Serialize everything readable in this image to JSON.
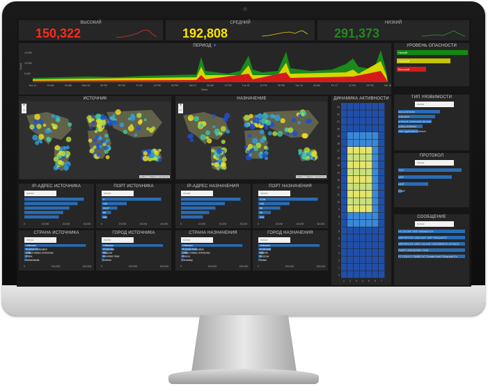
{
  "kpis": [
    {
      "label": "ВЫСОКИЙ",
      "value": "150,322",
      "color": "#ff2a1a",
      "spark": "#e23a2a"
    },
    {
      "label": "СРЕДНИЙ",
      "value": "192,808",
      "color": "#ffe400",
      "spark": "#e8d20a"
    },
    {
      "label": "НИЗКИЙ",
      "value": "291,373",
      "color": "#1f8a1f",
      "spark": "#2aa02a"
    }
  ],
  "period": {
    "title": "ПЕРИОД",
    "y_label": "Count",
    "y_ticks": [
      "15,000",
      "10,000",
      "5,000"
    ],
    "x_ticks": [
      "Nov 11",
      "03 AM",
      "06 AM",
      "Wed 16",
      "06 PM",
      "09 PM",
      "Fri 18",
      "12 PM",
      "09 PM",
      "Sat 19",
      "06 AM",
      "12 PM",
      "Tue 18",
      "12 PM",
      "09 PM",
      "Thu 16",
      "06 AM",
      "Fri 17",
      "12 PM",
      "09 PM",
      "Sat 18"
    ],
    "x_label": "Dates"
  },
  "severity": {
    "title": "УРОВЕНЬ ОПАСНОСТИ",
    "items": [
      {
        "label": "Низкий",
        "color": "#128a12",
        "fill": 1.0
      },
      {
        "label": "Средний",
        "color": "#c4c400",
        "fill": 0.75
      },
      {
        "label": "Высокий",
        "color": "#d61a1a",
        "fill": 0.4
      }
    ]
  },
  "source_map": {
    "title": "ИСТОЧНИК",
    "attribution": "Leaflet | © Mapbox Contributors"
  },
  "dest_map": {
    "title": "НАЗНАЧЕНИЕ",
    "attribution": "Leaflet | © Mapbox Contributors"
  },
  "activity": {
    "title": "ДИНАМИКА АКТИВНОСТИ",
    "rows": [
      "23",
      "22",
      "21",
      "20",
      "19",
      "18",
      "17",
      "16",
      "15",
      "14",
      "13",
      "12",
      "11",
      "10",
      "9",
      "8",
      "7",
      "6",
      "5",
      "4",
      "3",
      "2",
      "1",
      "0"
    ],
    "cols": [
      "1",
      "2",
      "3",
      "4",
      "5",
      "6",
      "7"
    ],
    "scale_min": "0",
    "scale_max": "12,578"
  },
  "vuln": {
    "title": "ТИП УЯЗВИМОСТИ",
    "search": "поиск",
    "items": [
      {
        "label": "bad-unknown",
        "value": 0.62
      },
      {
        "label": "unknown",
        "value": 0.55
      },
      {
        "label": "protocol-command-decode",
        "value": 0.5
      },
      {
        "label": "policy-violation",
        "value": 0.36
      },
      {
        "label": "web-application-attack",
        "value": 0.3
      }
    ]
  },
  "protocol": {
    "title": "ПРОТОКОЛ",
    "search": "поиск",
    "items": [
      {
        "label": "TCP",
        "value": 0.95
      },
      {
        "label": "ARP",
        "value": 0.8
      },
      {
        "label": "UDP",
        "value": 0.45
      },
      {
        "label": "ICMP",
        "value": 0.05
      }
    ]
  },
  "message": {
    "title": "СООБЩЕНИЕ",
    "search": "поиск",
    "items": [
      {
        "label": "HI CACHE SEE MISMATCH"
      },
      {
        "label": "ARPSPOOF UNICAST ARP REQUEST"
      },
      {
        "label": "ARPSPOOF ARP CACHE OVERWRITE ATTACK"
      },
      {
        "label": "RARP UNKNOWN CMD"
      },
      {
        "label": "ET POLICY SMB2 NT Create AndX Request Fo"
      }
    ]
  },
  "ip_src": {
    "title": "IP-АДРЕС ИСТОЧНИКА",
    "search": "поиск",
    "axis": [
      "0",
      "10,000",
      "20,000",
      "30,000"
    ],
    "values": [
      0.95,
      0.85,
      0.72,
      0.62,
      0.55
    ]
  },
  "port_src": {
    "title": "ПОРТ ИСТОЧНИКА",
    "search": "поиск",
    "axis": [
      "0",
      "20,000",
      "40,000",
      "60,000"
    ],
    "labels": [
      "0",
      "143",
      "24,37",
      "80",
      "443"
    ],
    "values": [
      0.95,
      0.4,
      0.25,
      0.15,
      0.08
    ]
  },
  "ip_dst": {
    "title": "IP-АДРЕС НАЗНАЧЕНИЯ",
    "search": "поиск",
    "axis": [
      "0",
      "10,000",
      "20,000",
      "30,000"
    ],
    "values": [
      0.95,
      0.7,
      0.55,
      0.45,
      0.35
    ]
  },
  "port_dst": {
    "title": "ПОРТ НАЗНАЧЕНИЯ",
    "search": "поиск",
    "axis": [
      "0",
      "20,000",
      "40,000",
      "60,000"
    ],
    "labels": [
      "3128",
      "143",
      "80",
      "33",
      "443"
    ],
    "values": [
      0.95,
      0.5,
      0.35,
      0.2,
      0.1
    ]
  },
  "country_src": {
    "title": "СТРАНА ИСТОЧНИКА",
    "search": "поиск",
    "axis": [
      "0",
      "200,000",
      "400,000"
    ],
    "labels": [
      "Unknown",
      "Russian Federation",
      "United States of America",
      "China",
      "Netherlands"
    ],
    "values": [
      0.98,
      0.22,
      0.1,
      0.05,
      0.03
    ]
  },
  "city_src": {
    "title": "ГОРОД ИСТОЧНИКА",
    "search": "поиск",
    "axis": [
      "0",
      "200,000",
      "400,000"
    ],
    "labels": [
      "Unknown",
      "Krasnodar",
      "Moscow",
      "Mountain View",
      "Hohhot"
    ],
    "values": [
      0.98,
      0.18,
      0.08,
      0.05,
      0.03
    ]
  },
  "country_dst": {
    "title": "СТРАНА НАЗНАЧЕНИЯ",
    "search": "поиск",
    "axis": [
      "0",
      "200,000",
      "400,000"
    ],
    "labels": [
      "Unknown",
      "Russian Federation",
      "United States of America",
      "France",
      "Germany"
    ],
    "values": [
      0.98,
      0.25,
      0.1,
      0.05,
      0.03
    ]
  },
  "city_dst": {
    "title": "ГОРОД НАЗНАЧЕНИЯ",
    "search": "поиск",
    "axis": [
      "0",
      "200,000",
      "400,000"
    ],
    "labels": [
      "Unknown",
      "Krasnodar",
      "Nalchik",
      "Moscow",
      "Tartan"
    ],
    "values": [
      0.98,
      0.2,
      0.08,
      0.05,
      0.03
    ]
  }
}
